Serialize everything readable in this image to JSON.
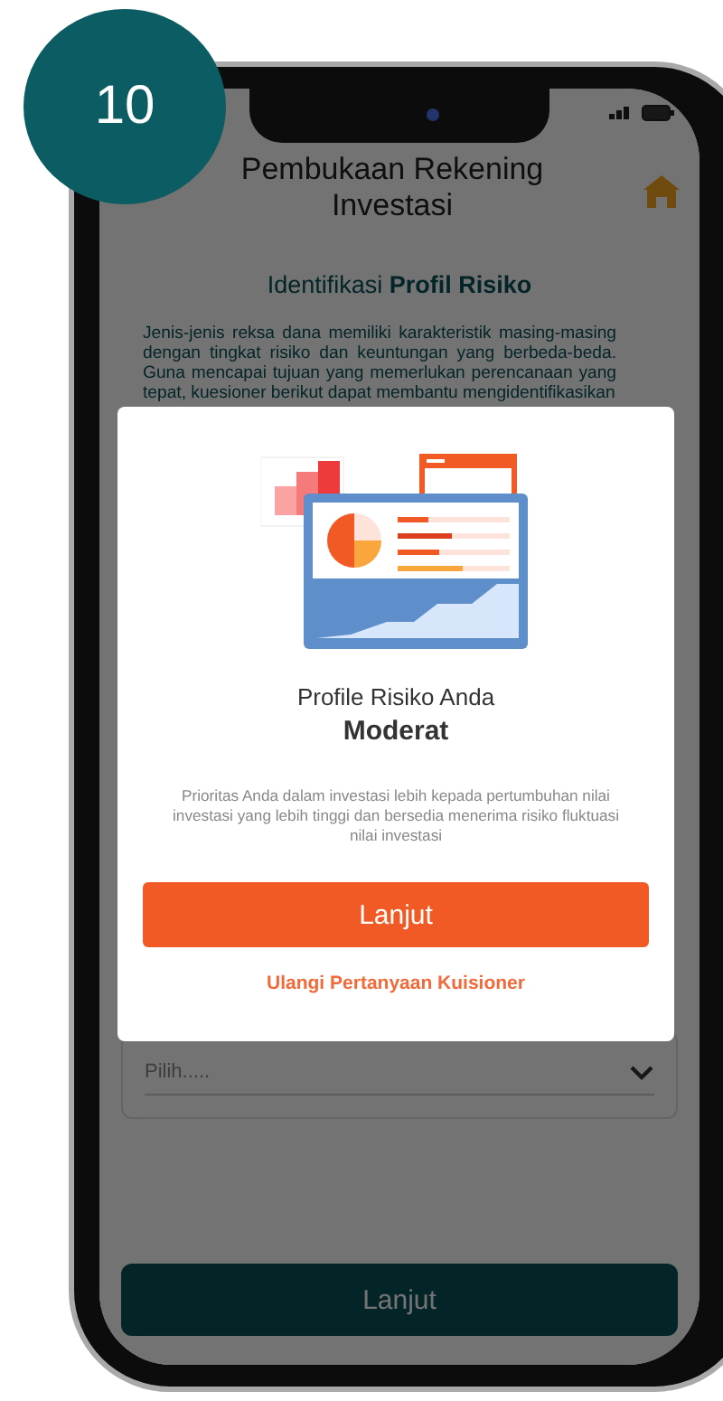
{
  "step_badge": "10",
  "header": {
    "title": "Pembukaan Rekening Investasi"
  },
  "section": {
    "heading": "Identifikasi **Profil Risiko**",
    "intro": "Jenis-jenis reksa dana memiliki karakteristik masing-masing dengan tingkat risiko dan keuntungan yang berbeda-beda. Guna mencapai tujuan yang memerlukan perencanaan yang tepat, kuesioner berikut dapat membantu mengidentifikasikan"
  },
  "select_field": {
    "placeholder": "Pilih....."
  },
  "footer_button": {
    "label": "Lanjut"
  },
  "modal": {
    "caption": "Profile Risiko Anda",
    "result": "Moderat",
    "description": "Prioritas Anda dalam investasi lebih kepada pertumbuhan nilai investasi yang lebih tinggi dan bersedia menerima risiko fluktuasi nilai investasi",
    "primary_button": "Lanjut",
    "link": "Ulangi Pertanyaan Kuisioner"
  }
}
